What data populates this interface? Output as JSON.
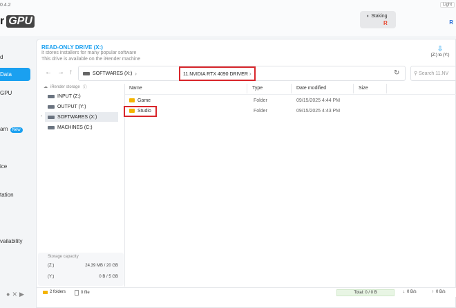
{
  "app": {
    "version": "0.4.2",
    "theme_label": "Light",
    "logo_text": "r",
    "logo_badge": "GPU",
    "staking_label": "Staking",
    "staking_icon_letter": "R",
    "user_letter": "R"
  },
  "sidebar": {
    "items": [
      {
        "label": "d"
      },
      {
        "label": "Data"
      },
      {
        "label": "GPU"
      },
      {
        "label": "arn"
      },
      {
        "label": "ice"
      },
      {
        "label": "tation"
      },
      {
        "label": "vailability"
      }
    ],
    "new_badge": "New"
  },
  "drive": {
    "title": "READ-ONLY DRIVE (X:)",
    "desc1": "It stores installers for many popular software",
    "desc2": "This drive is available on the iRender machine",
    "switch_label": "(Z:) to (Y:)"
  },
  "address": {
    "drive": "SOFTWARES (X:)",
    "folder": "11.NVIDIA RTX 4090 DRIVER",
    "search_placeholder": "Search 11.NV"
  },
  "tree": {
    "header": "iRender storage",
    "items": [
      {
        "label": "INPUT (Z:)"
      },
      {
        "label": "OUTPUT (Y:)"
      },
      {
        "label": "SOFTWARES (X:)"
      },
      {
        "label": "MACHINES (C:)"
      }
    ]
  },
  "storage": {
    "title": "Storage capacity",
    "rows": [
      {
        "label": "(Z:)",
        "value": "24.39 MB / 20 GB"
      },
      {
        "label": "(Y:)",
        "value": "0 B / 5 GB"
      }
    ]
  },
  "table": {
    "columns": [
      "Name",
      "Type",
      "Date modified",
      "Size"
    ],
    "rows": [
      {
        "name": "Game",
        "type": "Folder",
        "date": "09/15/2025 4:44 PM",
        "size": ""
      },
      {
        "name": "Studio",
        "type": "Folder",
        "date": "09/15/2025 4:43 PM",
        "size": ""
      }
    ]
  },
  "status": {
    "folders": "2 folders",
    "files": "0 file",
    "total": "Total: 0 / 0 B",
    "down": "0 B/s",
    "up": "0 B/s"
  }
}
